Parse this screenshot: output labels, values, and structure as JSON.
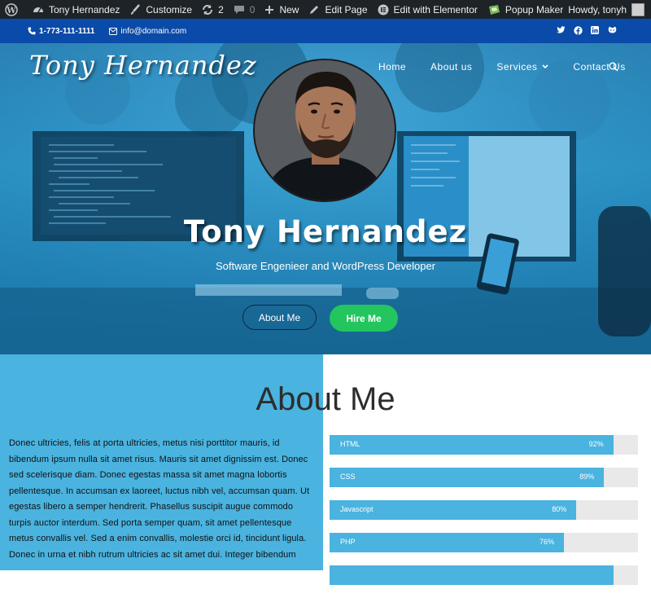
{
  "adminbar": {
    "site_name": "Tony Hernandez",
    "customize": "Customize",
    "updates": "2",
    "comments": "0",
    "new": "New",
    "edit_page": "Edit Page",
    "elementor": "Edit with Elementor",
    "popup": "Popup Maker",
    "howdy": "Howdy, tonyh"
  },
  "topbar": {
    "phone": "1-773-111-1111",
    "email": "info@domain.com",
    "socials": [
      "twitter-icon",
      "facebook-icon",
      "linkedin-icon",
      "github-icon"
    ]
  },
  "header": {
    "logo": "Tony Hernandez",
    "nav": [
      "Home",
      "About us",
      "Services",
      "Contact Us"
    ]
  },
  "hero": {
    "name": "Tony Hernandez",
    "subtitle": "Software Engenieer and WordPress Developer",
    "about_button": "About Me",
    "hire_button": "Hire Me"
  },
  "about": {
    "title": "About Me",
    "text": "Donec ultricies, felis at porta ultricies, metus nisi porttitor mauris, id bibendum ipsum nulla sit amet risus. Mauris sit amet dignissim est. Donec sed scelerisque diam. Donec egestas massa sit amet magna lobortis pellentesque. In accumsan ex laoreet, luctus nibh vel, accumsan quam. Ut egestas libero a semper hendrerit. Phasellus suscipit augue commodo turpis auctor interdum. Sed porta semper quam, sit amet pellentesque metus convallis vel. Sed a enim convallis, molestie orci id, tincidunt ligula. Donec in urna et nibh rutrum ultricies ac sit amet dui. Integer bibendum",
    "skills": [
      {
        "name": "HTML",
        "percent": "92%",
        "value": 92
      },
      {
        "name": "CSS",
        "percent": "89%",
        "value": 89
      },
      {
        "name": "Javascript",
        "percent": "80%",
        "value": 80
      },
      {
        "name": "PHP",
        "percent": "76%",
        "value": 76
      }
    ]
  },
  "colors": {
    "admin_bar": "#1d2327",
    "top_bar": "#0a4aa8",
    "accent": "#4ab3df",
    "hire": "#22c55e"
  }
}
